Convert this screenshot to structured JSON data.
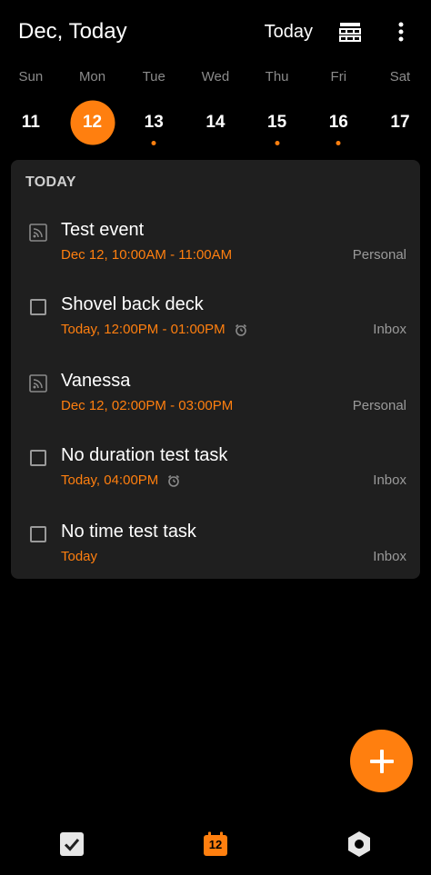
{
  "header": {
    "title": "Dec, Today",
    "today_label": "Today",
    "icons": [
      "week-view-icon",
      "more-vertical-icon"
    ]
  },
  "week": {
    "days": [
      {
        "weekday": "Sun",
        "date": "11",
        "selected": false,
        "has_event": false
      },
      {
        "weekday": "Mon",
        "date": "12",
        "selected": true,
        "has_event": false
      },
      {
        "weekday": "Tue",
        "date": "13",
        "selected": false,
        "has_event": true
      },
      {
        "weekday": "Wed",
        "date": "14",
        "selected": false,
        "has_event": false
      },
      {
        "weekday": "Thu",
        "date": "15",
        "selected": false,
        "has_event": true
      },
      {
        "weekday": "Fri",
        "date": "16",
        "selected": false,
        "has_event": true
      },
      {
        "weekday": "Sat",
        "date": "17",
        "selected": false,
        "has_event": false
      }
    ]
  },
  "agenda": {
    "header": "TODAY",
    "items": [
      {
        "type": "event",
        "title": "Test event",
        "time": "Dec 12, 10:00AM - 11:00AM",
        "list": "Personal",
        "alarm": false
      },
      {
        "type": "task",
        "title": "Shovel back deck",
        "time": "Today, 12:00PM - 01:00PM",
        "list": "Inbox",
        "alarm": true
      },
      {
        "type": "event",
        "title": "Vanessa",
        "time": "Dec 12, 02:00PM - 03:00PM",
        "list": "Personal",
        "alarm": false
      },
      {
        "type": "task",
        "title": "No duration test task",
        "time": "Today, 04:00PM",
        "list": "Inbox",
        "alarm": true
      },
      {
        "type": "task",
        "title": "No time test task",
        "time": "Today",
        "list": "Inbox",
        "alarm": false
      }
    ]
  },
  "fab": {
    "icon": "plus-icon"
  },
  "bottom_nav": {
    "calendar_date": "12",
    "icons": [
      "tasks-check-icon",
      "calendar-icon",
      "settings-hexagon-icon"
    ]
  },
  "colors": {
    "accent": "#ff7f0f",
    "background": "#000000",
    "card": "#1f1f1f",
    "muted_text": "#9a9a9a"
  }
}
